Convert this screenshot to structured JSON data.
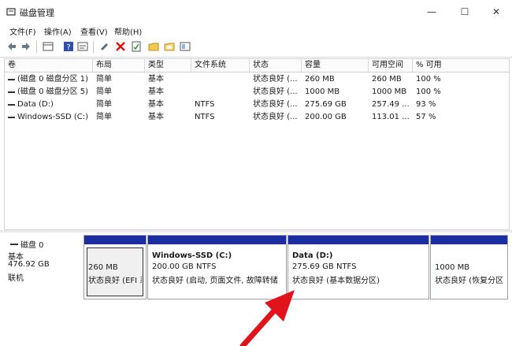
{
  "window": {
    "title": "磁盘管理",
    "minimize": "—",
    "maximize": "☐",
    "close": "✕"
  },
  "menu": [
    "文件(F)",
    "操作(A)",
    "查看(V)",
    "帮助(H)"
  ],
  "table": {
    "columns": [
      "卷",
      "布局",
      "类型",
      "文件系统",
      "状态",
      "容量",
      "可用空间",
      "% 可用"
    ],
    "rows": [
      {
        "vol": "(磁盘 0 磁盘分区 1)",
        "layout": "简单",
        "type": "基本",
        "fs": "",
        "status": "状态良好 (...",
        "cap": "260 MB",
        "free": "260 MB",
        "pct": "100 %"
      },
      {
        "vol": "(磁盘 0 磁盘分区 5)",
        "layout": "简单",
        "type": "基本",
        "fs": "",
        "status": "状态良好 (...",
        "cap": "1000 MB",
        "free": "1000 MB",
        "pct": "100 %"
      },
      {
        "vol": "Data (D:)",
        "layout": "简单",
        "type": "基本",
        "fs": "NTFS",
        "status": "状态良好 (...",
        "cap": "275.69 GB",
        "free": "257.49 ...",
        "pct": "93 %"
      },
      {
        "vol": "Windows-SSD (C:)",
        "layout": "简单",
        "type": "基本",
        "fs": "NTFS",
        "status": "状态良好 (...",
        "cap": "200.00 GB",
        "free": "113.01 ...",
        "pct": "57 %"
      }
    ]
  },
  "disk": {
    "name": "磁盘 0",
    "type": "基本",
    "size": "476.92 GB",
    "status": "联机",
    "partitions": [
      {
        "title": "",
        "size": "260 MB",
        "status": "状态良好 (EFI 系"
      },
      {
        "title": "Windows-SSD  (C:)",
        "size": "200.00 GB NTFS",
        "status": "状态良好 (启动, 页面文件, 故障转储"
      },
      {
        "title": "Data  (D:)",
        "size": "275.69 GB NTFS",
        "status": "状态良好 (基本数据分区)"
      },
      {
        "title": "",
        "size": "1000 MB",
        "status": "状态良好 (恢复分区"
      }
    ]
  },
  "colors": {
    "partition_bar": "#1c2da3",
    "arrow": "#e0141b"
  }
}
